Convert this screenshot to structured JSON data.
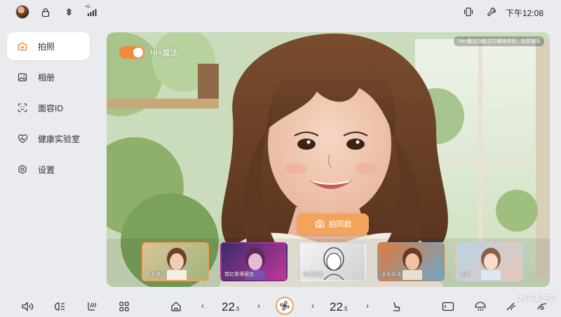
{
  "status": {
    "time": "下午12:08",
    "signal_label": "4G"
  },
  "sidebar": {
    "items": [
      {
        "label": "拍照"
      },
      {
        "label": "相册"
      },
      {
        "label": "面容ID"
      },
      {
        "label": "健康实验室"
      },
      {
        "label": "设置"
      }
    ]
  },
  "panel": {
    "toggle_label": "NI+魔法",
    "notice": "\"NI+魔法功能主打趣味体验，仅供娱乐",
    "shoot_button": "拍同款",
    "thumbnails": [
      {
        "label": "色彩速写"
      },
      {
        "label": "霓虹赛博朋克"
      },
      {
        "label": "动漫线稿"
      },
      {
        "label": "多彩厚涂"
      },
      {
        "label": "水彩"
      }
    ]
  },
  "climate": {
    "left_temp": "22",
    "left_temp_decimal": ".5",
    "right_temp": "22",
    "right_temp_decimal": ".5",
    "left_arrow": "‹",
    "right_arrow": "›"
  },
  "watermark": "太平洋汽车",
  "colors": {
    "accent": "#f3a15b",
    "toggle": "#f08a3c"
  }
}
